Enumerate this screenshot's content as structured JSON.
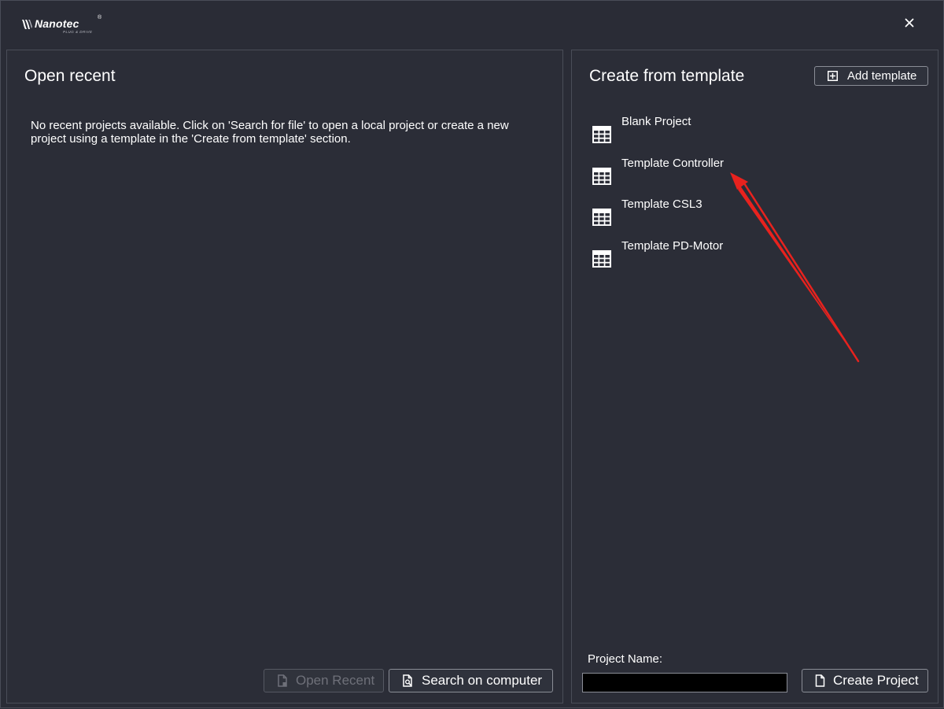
{
  "window": {
    "logo": {
      "brand": "Nanotec",
      "registered": "®",
      "tagline": "PLUG & DRIVE"
    },
    "close_symbol": "×"
  },
  "open_recent": {
    "title": "Open recent",
    "empty_message": "No recent projects available. Click on 'Search for file' to open a local project or create a new project using a template in the 'Create from template' section.",
    "buttons": {
      "open_recent": {
        "label": "Open Recent",
        "icon": "file-icon",
        "enabled": false
      },
      "search": {
        "label": "Search on computer",
        "icon": "file-search-icon",
        "enabled": true
      }
    }
  },
  "create_from_template": {
    "title": "Create from template",
    "add_template": {
      "label": "Add template",
      "icon": "plus-square-icon"
    },
    "templates": [
      {
        "label": "Blank Project",
        "icon": "grid-table-icon"
      },
      {
        "label": "Template Controller",
        "icon": "grid-table-icon"
      },
      {
        "label": "Template CSL3",
        "icon": "grid-table-icon"
      },
      {
        "label": "Template PD-Motor",
        "icon": "grid-table-icon"
      }
    ],
    "project_name": {
      "label": "Project Name:",
      "value": "",
      "placeholder": ""
    },
    "create_button": {
      "label": "Create Project",
      "icon": "file-icon"
    }
  },
  "colors": {
    "background": "#2a2c36",
    "panel_border": "#4a4d58",
    "text": "#ffffff",
    "disabled_text": "#6e7079",
    "annotation_arrow": "#e8221e"
  }
}
